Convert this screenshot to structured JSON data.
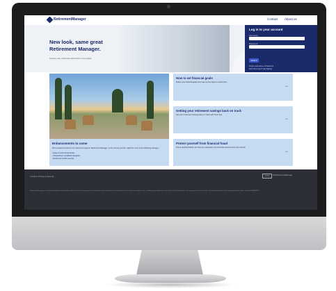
{
  "brand": {
    "name": "RetirementManager"
  },
  "nav": {
    "links": [
      "Contact",
      "About us"
    ]
  },
  "hero": {
    "title": "New look, same great Retirement Manager.",
    "subtitle": "Access your retirement accounts in one place"
  },
  "login": {
    "title": "Log in to your account",
    "username_label": "Username",
    "password_label": "Password",
    "button": "Submit",
    "forgot_link": "Forgot username or Password",
    "help_link": "First Time User? Get Started"
  },
  "feature": {
    "title": "Enhancements to come",
    "description": "We're pleased to launch our new home page for Retirement Manager. In the coming months, watch for more of the following changes:",
    "list": [
      "Easy-to-read visual design",
      "Streamlined, simplified navigation",
      "Enhanced mobile security"
    ]
  },
  "cards": [
    {
      "title": "How to set financial goals",
      "description": "Define your financial goals and map out the steps to reach them."
    },
    {
      "title": "Getting your retirement savings back on track",
      "description": "Get your retirement savings plans on track with these tips."
    },
    {
      "title": "Protect yourself from financial fraud",
      "description": "These practical habits can help you safeguard your financial accounts and your identity."
    }
  ],
  "footer": {
    "links": "Contact | Privacy & Security",
    "badge": "AICPA",
    "brand": "ASCRetirementManager",
    "fine_print": "Retirement Manager is a web-based platform that provides online access to retirement plan account information. Investments in retirement plan accounts are subject to risk, including the possible loss of principal. Past performance is not a guarantee of future results. Securities offered through a registered broker-dealer, member FINRA/SIPC."
  },
  "colors": {
    "brand_navy": "#1b2a6b",
    "card_blue": "#c6dbf2",
    "footer_bg": "#2c2f36"
  }
}
